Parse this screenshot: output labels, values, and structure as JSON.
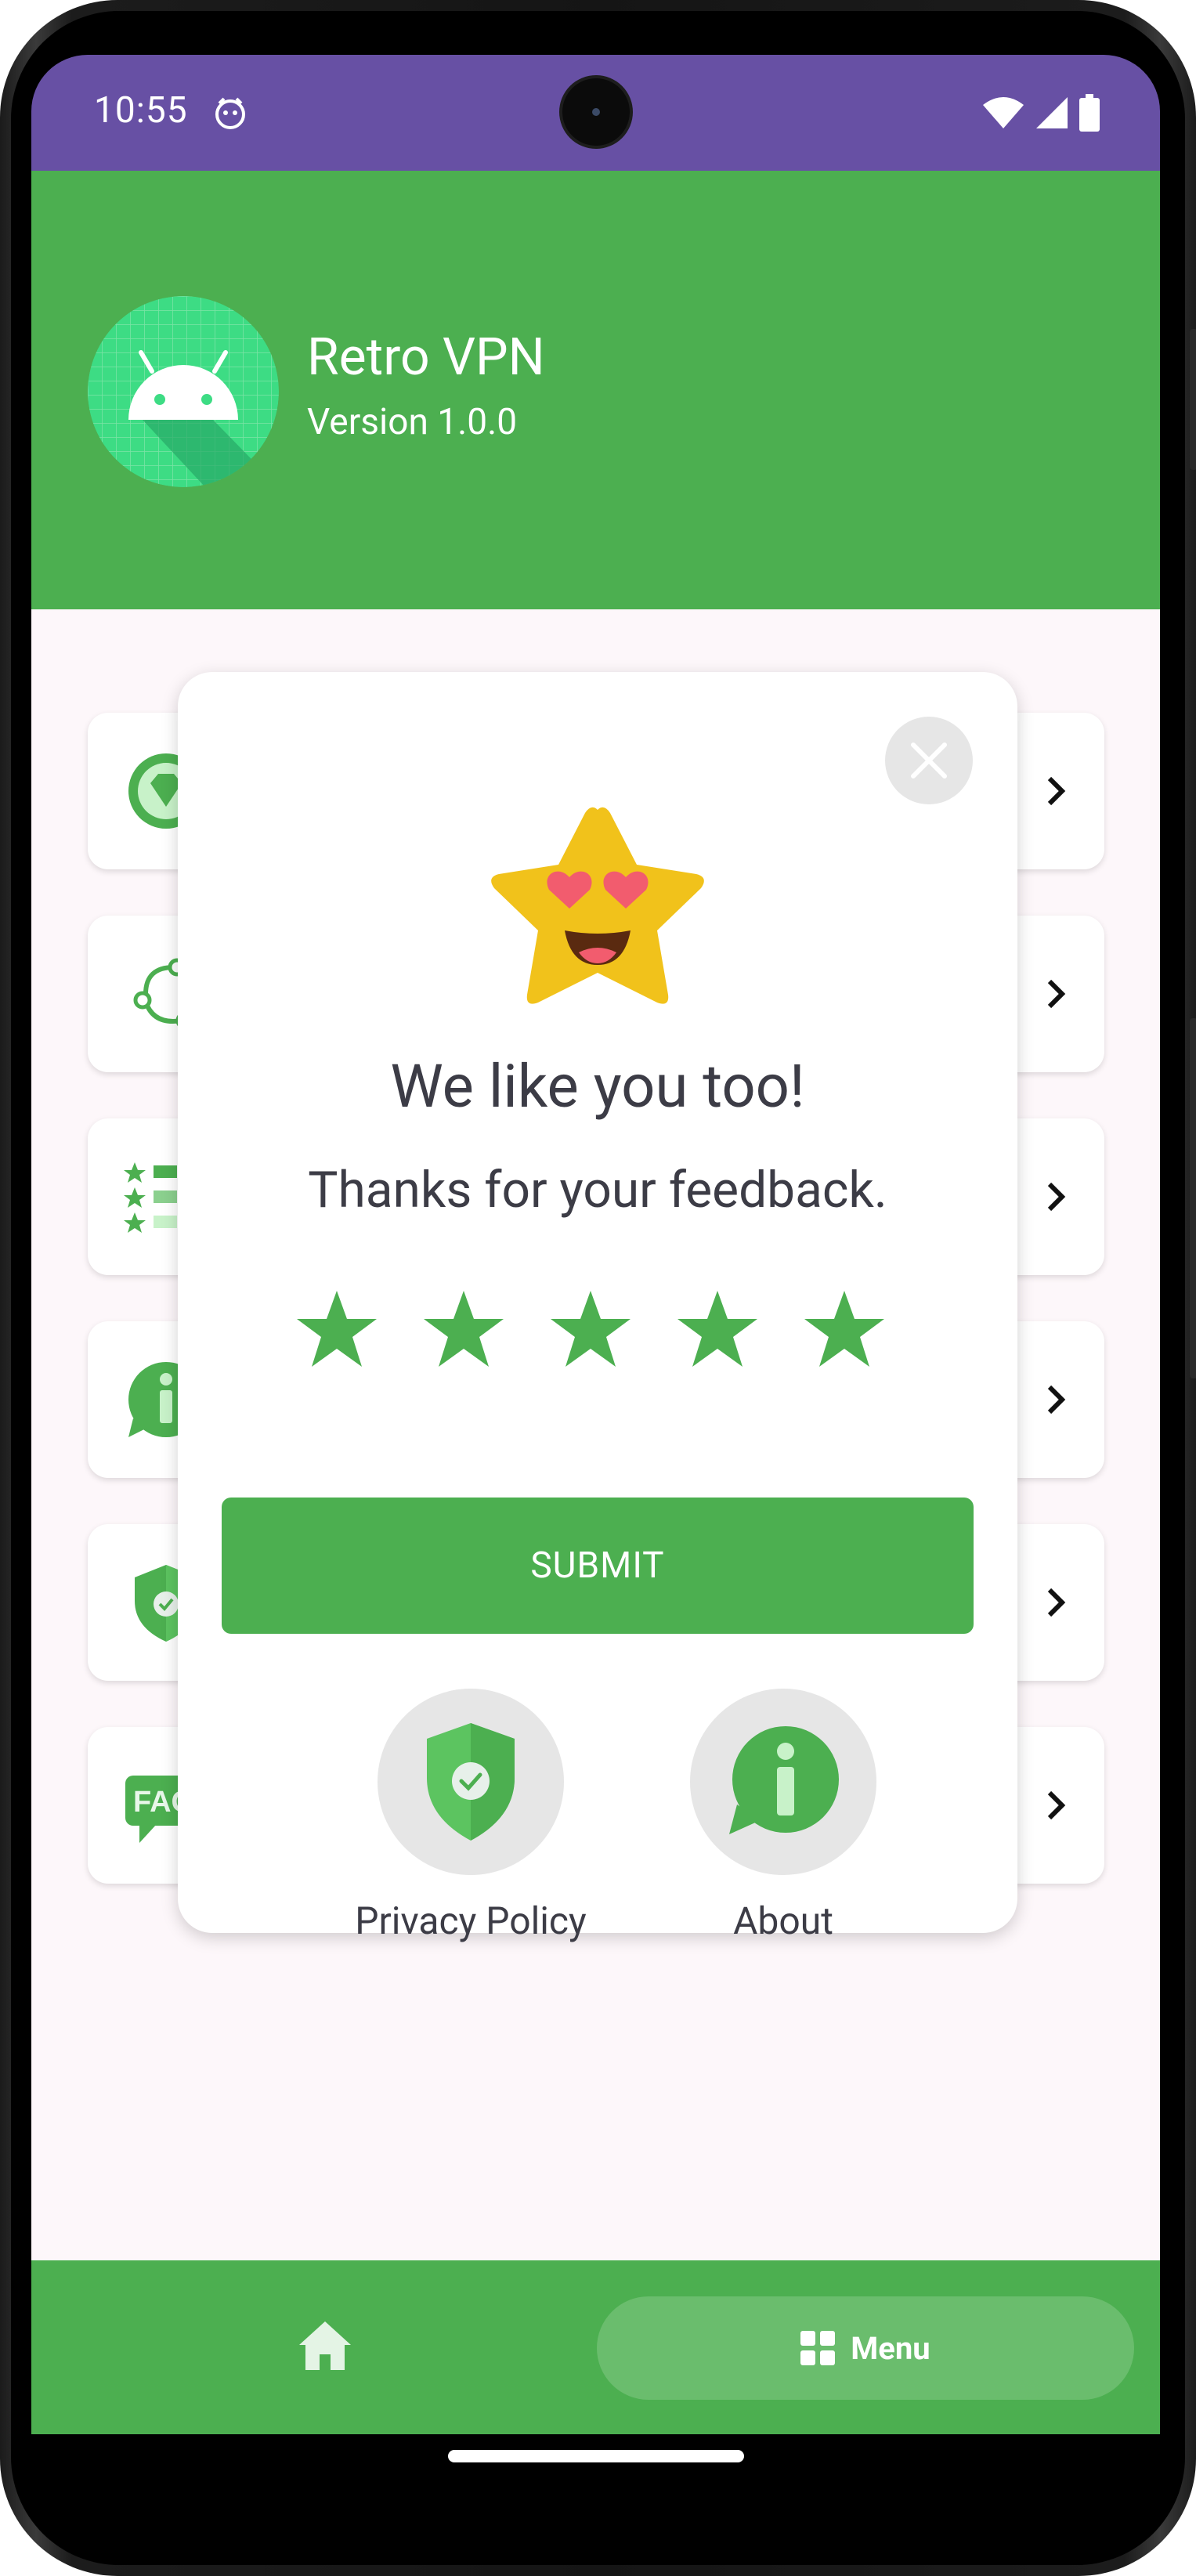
{
  "status_bar": {
    "time": "10:55",
    "icons": [
      "smiley-notification-icon",
      "wifi-icon",
      "signal-icon",
      "battery-icon"
    ]
  },
  "header": {
    "title": "Retro VPN",
    "version": "Version 1.0.0",
    "logo_icon": "android-logo-icon"
  },
  "menu_cards": [
    {
      "icon": "premium-badge-icon"
    },
    {
      "icon": "share-icon"
    },
    {
      "icon": "rate-list-icon"
    },
    {
      "icon": "info-icon"
    },
    {
      "icon": "privacy-shield-icon"
    },
    {
      "icon": "faq-icon"
    }
  ],
  "dialog": {
    "title": "We like you too!",
    "subtitle": "Thanks for your feedback.",
    "rating": 5,
    "rating_max": 5,
    "submit_label": "SUBMIT",
    "privacy_label": "Privacy Policy",
    "about_label": "About"
  },
  "bottom_nav": {
    "menu_label": "Menu"
  },
  "colors": {
    "primary": "#4caf50",
    "status_bar": "#6750a4",
    "star_yellow": "#f1c21b",
    "text": "#3c3c46"
  }
}
